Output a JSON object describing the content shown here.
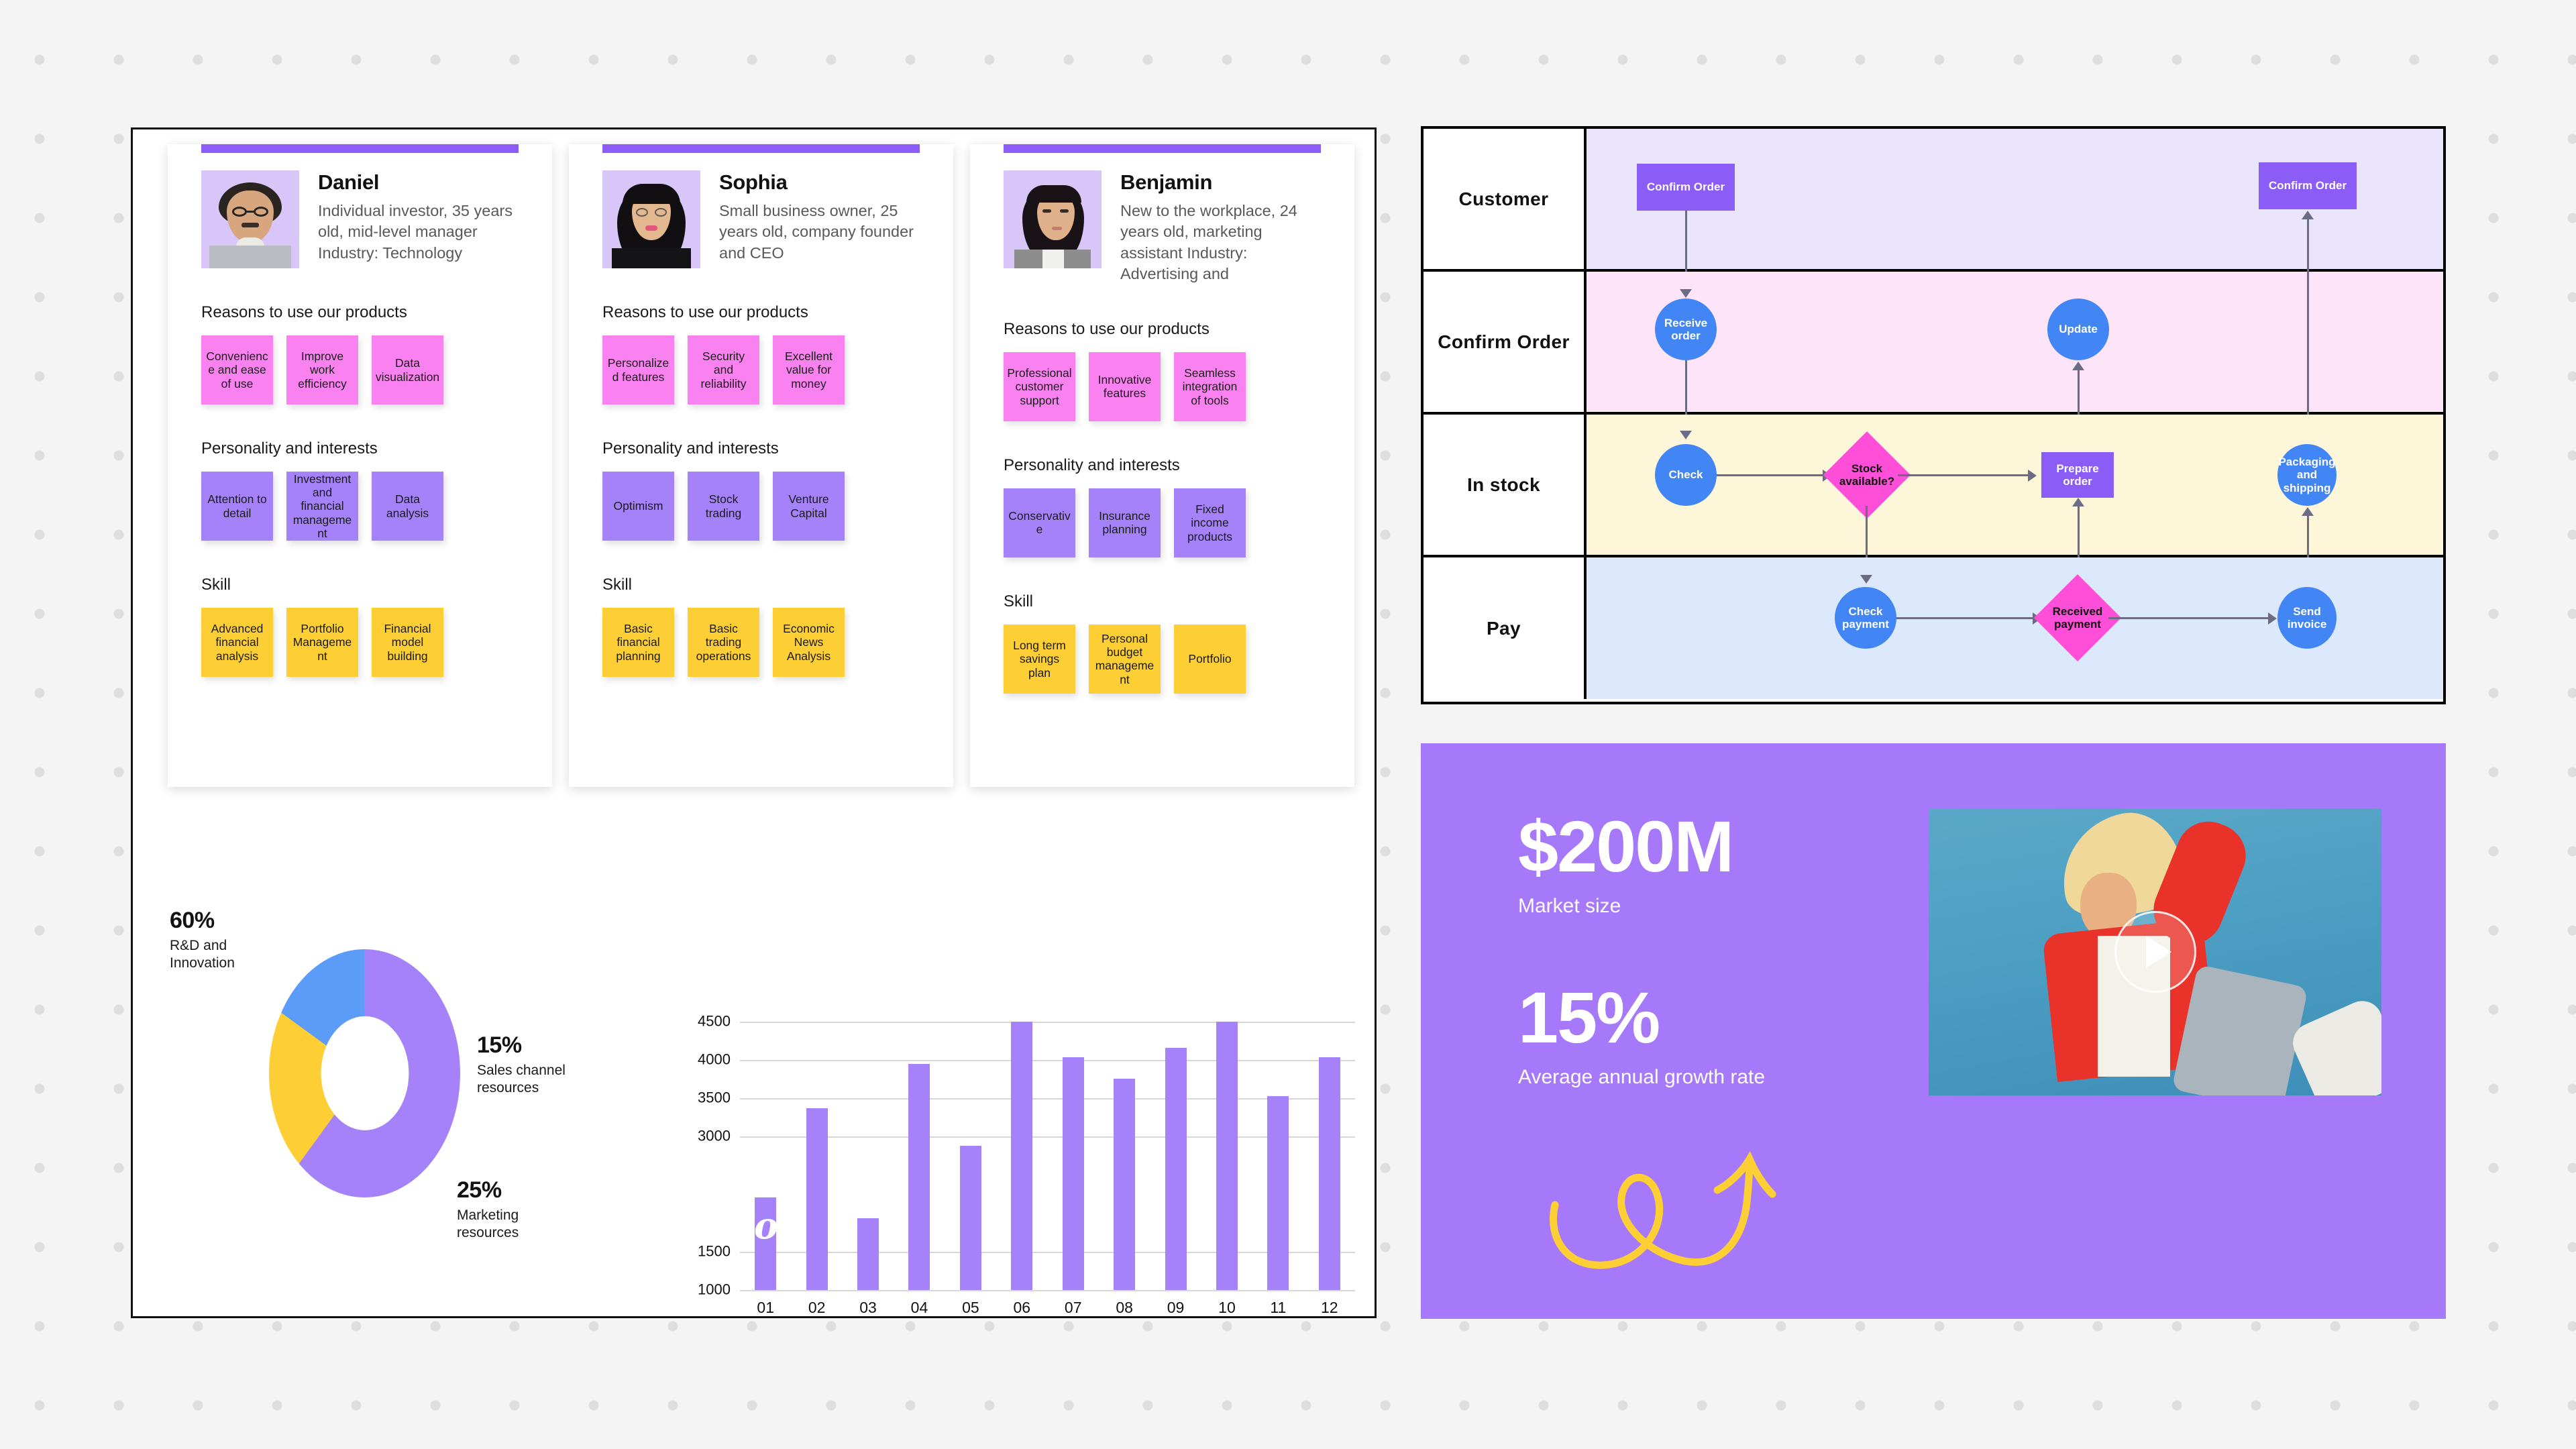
{
  "personas": [
    {
      "name": "Daniel",
      "description": "Individual investor, 35 years old, mid-level manager Industry: Technology",
      "avatar_icon": "avatar-photo-daniel",
      "sections": [
        {
          "title": "Reasons to use our products",
          "color": "pink",
          "tags": [
            "Convenience and ease of use",
            "Improve work efficiency",
            "Data visualization"
          ]
        },
        {
          "title": "Personality and interests",
          "color": "purple",
          "tags": [
            "Attention to detail",
            "Investment and financial management",
            "Data analysis"
          ]
        },
        {
          "title": "Skill",
          "color": "yellow",
          "tags": [
            "Advanced financial analysis",
            "Portfolio Management",
            "Financial model building"
          ]
        }
      ]
    },
    {
      "name": "Sophia",
      "description": "Small business owner, 25 years old, company founder and CEO",
      "avatar_icon": "avatar-photo-sophia",
      "sections": [
        {
          "title": "Reasons to use our products",
          "color": "pink",
          "tags": [
            "Personalized features",
            "Security and reliability",
            "Excellent value for money"
          ]
        },
        {
          "title": "Personality and interests",
          "color": "purple",
          "tags": [
            "Optimism",
            "Stock trading",
            "Venture Capital"
          ]
        },
        {
          "title": "Skill",
          "color": "yellow",
          "tags": [
            "Basic financial planning",
            "Basic trading operations",
            "Economic News Analysis"
          ]
        }
      ]
    },
    {
      "name": "Benjamin",
      "description": "New to the workplace, 24 years old, marketing assistant Industry: Advertising and",
      "avatar_icon": "avatar-photo-benjamin",
      "sections": [
        {
          "title": "Reasons to use our products",
          "color": "pink",
          "tags": [
            "Professional customer support",
            "Innovative features",
            "Seamless integration of tools"
          ]
        },
        {
          "title": "Personality and interests",
          "color": "purple",
          "tags": [
            "Conservative",
            "Insurance planning",
            "Fixed income products"
          ]
        },
        {
          "title": "Skill",
          "color": "yellow",
          "tags": [
            "Long term savings plan",
            "Personal budget management",
            "Portfolio"
          ]
        }
      ]
    }
  ],
  "chart_data": [
    {
      "type": "pie",
      "title": "",
      "variant": "donut",
      "categories": [
        "R&D and Innovation",
        "Marketing resources",
        "Sales channel resources"
      ],
      "values": [
        60,
        25,
        15
      ],
      "labels": [
        "60%",
        "25%",
        "15%"
      ],
      "colors": [
        "#a682fa",
        "#fdcf34",
        "#5b9cf8"
      ],
      "legend": "outside-labels",
      "annotations": [
        {
          "pct": "60%",
          "caption": "R&D and Innovation",
          "position": "top-left"
        },
        {
          "pct": "15%",
          "caption": "Sales channel resources",
          "position": "right"
        },
        {
          "pct": "25%",
          "caption": "Marketing resources",
          "position": "bottom-right"
        }
      ]
    },
    {
      "type": "bar",
      "title": "",
      "xlabel": "",
      "ylabel": "",
      "categories": [
        "01",
        "02",
        "03",
        "04",
        "05",
        "06",
        "07",
        "08",
        "09",
        "10",
        "11",
        "12"
      ],
      "values": [
        2210,
        3370,
        1940,
        3950,
        2880,
        4500,
        4040,
        3760,
        4160,
        4500,
        3530,
        4040
      ],
      "ylim": [
        1000,
        4500
      ],
      "yticks": [
        1000,
        1500,
        3000,
        3500,
        4000,
        4500
      ],
      "ytick_labels": [
        "1000",
        "1500",
        "3000",
        "3500",
        "4000",
        "4500"
      ],
      "grid": true,
      "bar_color": "#a682fa",
      "legend": "none"
    }
  ],
  "flowchart": {
    "rows": [
      {
        "label": "Customer",
        "band_color": "#eae4fd"
      },
      {
        "label": "Confirm Order",
        "band_color": "#fde4f8"
      },
      {
        "label": "In stock",
        "band_color": "#fdf6d9"
      },
      {
        "label": "Pay",
        "band_color": "#dce8fb"
      }
    ],
    "nodes": [
      {
        "id": "n1",
        "label": "Confirm Order",
        "shape": "rect",
        "row": 0
      },
      {
        "id": "n2",
        "label": "Confirm Order",
        "shape": "rect",
        "row": 0
      },
      {
        "id": "n3",
        "label": "Receive order",
        "shape": "ellipse",
        "row": 1
      },
      {
        "id": "n4",
        "label": "Update",
        "shape": "ellipse",
        "row": 1
      },
      {
        "id": "n5",
        "label": "Check",
        "shape": "ellipse",
        "row": 2
      },
      {
        "id": "n6",
        "label": "Stock available?",
        "shape": "diamond",
        "row": 2
      },
      {
        "id": "n7",
        "label": "Prepare order",
        "shape": "rect",
        "row": 2
      },
      {
        "id": "n8",
        "label": "Packaging and shipping",
        "shape": "ellipse",
        "row": 2
      },
      {
        "id": "n9",
        "label": "Check payment",
        "shape": "ellipse",
        "row": 3
      },
      {
        "id": "n10",
        "label": "Received payment",
        "shape": "diamond",
        "row": 3
      },
      {
        "id": "n11",
        "label": "Send invoice",
        "shape": "ellipse",
        "row": 3
      }
    ],
    "colors": {
      "rect": "#8b5cf6",
      "ellipse": "#4285f4",
      "diamond": "#ff4fd8",
      "connector": "#6b6b85"
    }
  },
  "promo": {
    "stat1_value": "$200M",
    "stat1_caption": "Market size",
    "stat2_value": "15%",
    "stat2_caption": "Average annual growth rate",
    "annotation": "video",
    "play_icon": "play-button-icon",
    "background_color": "#a678fa",
    "annotation_color": "#fdcf34"
  }
}
